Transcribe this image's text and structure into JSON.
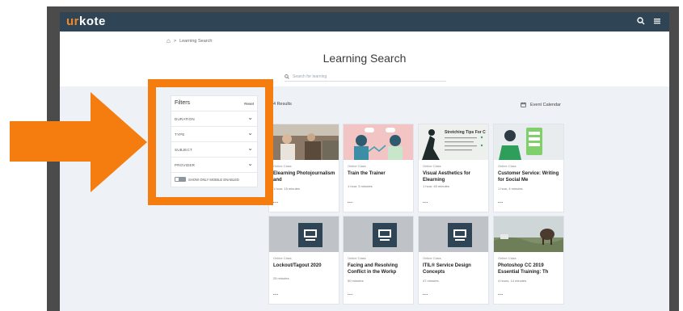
{
  "app": {
    "logo_prefix": "ur",
    "logo_suffix": "kote",
    "search_icon": "search-icon",
    "menu_icon": "menu-icon"
  },
  "breadcrumb": {
    "current": "Learning Search",
    "separator": ">"
  },
  "header": {
    "title": "Learning Search",
    "search_placeholder": "Search for learning"
  },
  "filters": {
    "title": "Filters",
    "reset_label": "Reset",
    "rows": [
      {
        "label": "DURATION"
      },
      {
        "label": "TYPE"
      },
      {
        "label": "SUBJECT"
      },
      {
        "label": "PROVIDER"
      }
    ],
    "mobile_toggle_label": "SHOW ONLY MOBILE ENABLED"
  },
  "results": {
    "count_text": "4 Results",
    "event_calendar_label": "Event Calendar"
  },
  "cards": [
    {
      "type": "Online Class",
      "title": "Elearning Photojournalism and",
      "duration": "1 hour, 15 minutes",
      "more": "..."
    },
    {
      "type": "Online Class",
      "title": "Train the Trainer",
      "duration": "1 hour, 5 minutes",
      "more": "..."
    },
    {
      "type": "Online Class",
      "title": "Visual Aesthetics for Elearning",
      "duration": "1 hour, 45 minutes",
      "more": "..."
    },
    {
      "type": "Online Class",
      "title": "Customer Service: Writing for Social Me",
      "duration": "1 hour, 4 minutes",
      "more": "..."
    },
    {
      "type": "Online Class",
      "title": "Lockout/Tagout 2020",
      "duration": "25 minutes",
      "more": "..."
    },
    {
      "type": "Online Class",
      "title": "Facing and Resolving Conflict in the Workp",
      "duration": "50 minutes",
      "more": "..."
    },
    {
      "type": "Online Class",
      "title": "ITIL® Service Design Concepts",
      "duration": "47 minutes",
      "more": "..."
    },
    {
      "type": "Online Class",
      "title": "Photoshop CC 2019 Essential Training: Th",
      "duration": "4 hours, 14 minutes",
      "more": "..."
    }
  ],
  "thumb_texts": {
    "card3": "Stretching Tips For C"
  },
  "colors": {
    "topbar": "#2f4454",
    "accent_orange": "#f57d10",
    "logo_accent": "#f08a24"
  }
}
